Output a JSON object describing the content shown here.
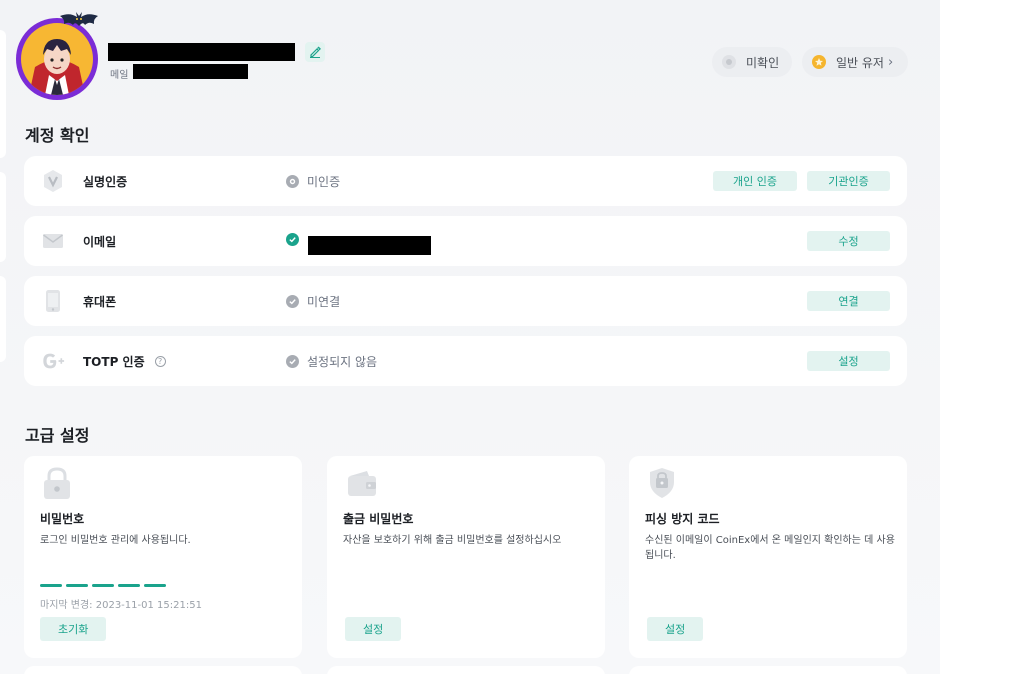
{
  "header": {
    "email_label": "메일",
    "badges": [
      {
        "label": "미확인"
      },
      {
        "label": "일반 유저",
        "chevron": "›"
      }
    ]
  },
  "account_verification": {
    "title": "계정 확인",
    "rows": [
      {
        "name": "실명인증",
        "icon": "verified-v-icon",
        "status": "미인증",
        "buttons": [
          "개인 인증",
          "기관인증"
        ]
      },
      {
        "name": "이메일",
        "icon": "mail-icon",
        "status": "",
        "buttons": [
          "수정"
        ]
      },
      {
        "name": "휴대폰",
        "icon": "phone-icon",
        "status": "미연결",
        "buttons": [
          "연결"
        ]
      },
      {
        "name": "TOTP 인증",
        "icon": "google-auth-icon",
        "status": "설정되지 않음",
        "buttons": [
          "설정"
        ]
      }
    ]
  },
  "advanced": {
    "title": "고급 설정",
    "cards": [
      {
        "title": "비밀번호",
        "desc": "로그인 비밀번호 관리에 사용됩니다.",
        "last_changed": "마지막 변경: 2023-11-01 15:21:51",
        "button": "초기화",
        "icon": "lock-icon"
      },
      {
        "title": "출금 비밀번호",
        "desc": "자산을 보호하기 위해 출금 비밀번호를 설정하십시오",
        "button": "설정",
        "icon": "wallet-icon"
      },
      {
        "title": "피싱 방지 코드",
        "desc": "수신된 이메일이 CoinEx에서 온 메일인지 확인하는 데 사용됩니다.",
        "button": "설정",
        "icon": "shield-icon"
      }
    ]
  },
  "colors": {
    "accent": "#1aa38c",
    "accent_bg": "#e3f3f0",
    "avatar_ring": "#7b2cd6"
  }
}
